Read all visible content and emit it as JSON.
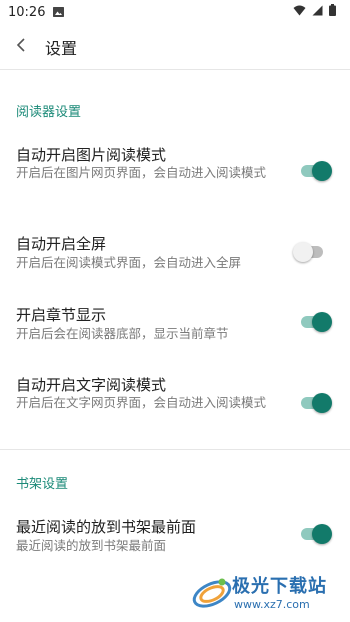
{
  "status_bar": {
    "time": "10:26",
    "icons": [
      "image-icon",
      "wifi-icon",
      "signal-icon",
      "battery-icon"
    ]
  },
  "app_bar": {
    "back_icon": "chevron-left-icon",
    "title": "设置"
  },
  "sections": [
    {
      "header": "阅读器设置",
      "items": [
        {
          "title": "自动开启图片阅读模式",
          "subtitle": "开启后在图片网页界面，会自动进入阅读模式",
          "enabled": true
        },
        {
          "title": "自动开启全屏",
          "subtitle": "开启后在阅读模式界面，会自动进入全屏",
          "enabled": false
        },
        {
          "title": "开启章节显示",
          "subtitle": "开启后会在阅读器底部，显示当前章节",
          "enabled": true
        },
        {
          "title": "自动开启文字阅读模式",
          "subtitle": "开启后在文字网页界面，会自动进入阅读模式",
          "enabled": true
        }
      ]
    },
    {
      "header": "书架设置",
      "items": [
        {
          "title": "最近阅读的放到书架最前面",
          "subtitle": "最近阅读的放到书架最前面",
          "enabled": true
        }
      ]
    }
  ],
  "watermark": {
    "text": "极光下载站",
    "url": "www.xz7.com"
  },
  "colors": {
    "accent": "#1b8a78",
    "switch_on_thumb": "#127a6a",
    "switch_on_track": "#8fc9be",
    "switch_off_thumb": "#f1f1f1",
    "switch_off_track": "#bdbdbd"
  }
}
